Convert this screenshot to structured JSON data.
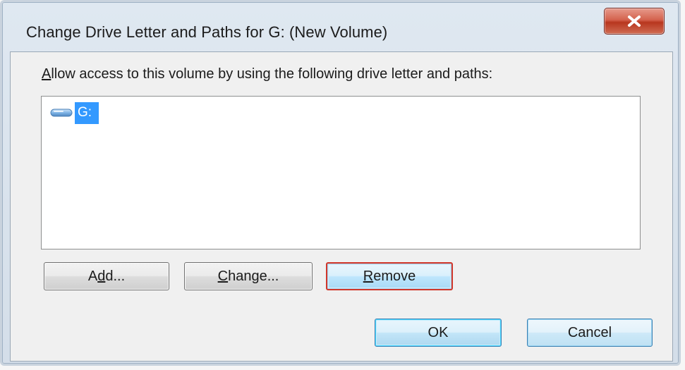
{
  "window": {
    "title": "Change Drive Letter and Paths for G: (New Volume)",
    "close_icon": "close-icon"
  },
  "dialog": {
    "prompt_prefix": "A",
    "prompt_rest": "llow access to this volume by using the following drive letter and paths:",
    "list_items": [
      {
        "icon": "drive-icon",
        "label": "G:",
        "selected": true
      }
    ]
  },
  "buttons": {
    "add_prefix": "A",
    "add_underlined": "d",
    "add_rest": "d...",
    "change_underlined": "C",
    "change_rest": "hange...",
    "remove_underlined": "R",
    "remove_rest": "emove",
    "ok": "OK",
    "cancel": "Cancel"
  },
  "colors": {
    "selection": "#3399ff",
    "close_button": "#c9452c",
    "focus_border": "#d1362a"
  }
}
